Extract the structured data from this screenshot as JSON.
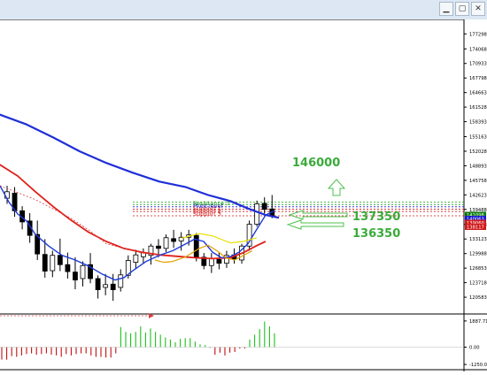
{
  "window": {
    "buttons": [
      {
        "name": "minimize-button",
        "glyph": "▁"
      },
      {
        "name": "maximize-button",
        "glyph": "▢"
      },
      {
        "name": "close-button",
        "glyph": "✕"
      }
    ]
  },
  "price_axis": {
    "ticks": [
      "177298",
      "174068",
      "170933",
      "167798",
      "164663",
      "161528",
      "158393",
      "155163",
      "152028",
      "148893",
      "145758",
      "142623",
      "139488",
      "136258",
      "133123",
      "129988",
      "126853",
      "123718",
      "120583"
    ]
  },
  "price_markers": [
    {
      "label": "141098",
      "color": "#0a7a0a"
    },
    {
      "label": "140063",
      "color": "#1a1ad0"
    },
    {
      "label": "139060",
      "color": "#d01a1a"
    },
    {
      "label": "138117",
      "color": "#d01a1a"
    }
  ],
  "level_labels": [
    {
      "text": "Resistance 3",
      "color": "#19a019"
    },
    {
      "text": "Pivot level",
      "color": "#1a1ad0"
    },
    {
      "text": "Support 1",
      "color": "#d01a1a"
    },
    {
      "text": "Support 2",
      "color": "#d01a1a"
    },
    {
      "text": "Support 3",
      "color": "#d01a1a"
    }
  ],
  "annotations": {
    "target_up": "146000",
    "level_a": "137350",
    "level_b": "136350",
    "text_color": "#3aab3a"
  },
  "osc_axis": {
    "ticks": [
      "1887.71",
      "0.00",
      "-1250.00"
    ]
  },
  "chart_data": {
    "type": "candlestick",
    "title": "",
    "ylim": [
      118500,
      178500
    ],
    "candles": [
      {
        "o": 141900,
        "h": 144600,
        "l": 140700,
        "c": 143300
      },
      {
        "o": 143000,
        "h": 144300,
        "l": 137900,
        "c": 139200
      },
      {
        "o": 139200,
        "h": 140200,
        "l": 135200,
        "c": 136800
      },
      {
        "o": 137000,
        "h": 138700,
        "l": 132300,
        "c": 133900
      },
      {
        "o": 134100,
        "h": 137100,
        "l": 128600,
        "c": 129900
      },
      {
        "o": 129800,
        "h": 133100,
        "l": 124800,
        "c": 126200
      },
      {
        "o": 126300,
        "h": 130600,
        "l": 124900,
        "c": 129600
      },
      {
        "o": 129600,
        "h": 133200,
        "l": 126200,
        "c": 127600
      },
      {
        "o": 127600,
        "h": 130200,
        "l": 124600,
        "c": 126100
      },
      {
        "o": 126000,
        "h": 129200,
        "l": 122300,
        "c": 124300
      },
      {
        "o": 124600,
        "h": 128300,
        "l": 122900,
        "c": 127400
      },
      {
        "o": 127600,
        "h": 130100,
        "l": 123600,
        "c": 124600
      },
      {
        "o": 124600,
        "h": 125300,
        "l": 120300,
        "c": 122200
      },
      {
        "o": 122700,
        "h": 125600,
        "l": 121000,
        "c": 123300
      },
      {
        "o": 123400,
        "h": 125600,
        "l": 119800,
        "c": 122200
      },
      {
        "o": 122700,
        "h": 126600,
        "l": 121800,
        "c": 125400
      },
      {
        "o": 125300,
        "h": 129600,
        "l": 124600,
        "c": 128500
      },
      {
        "o": 128100,
        "h": 130800,
        "l": 126600,
        "c": 129700
      },
      {
        "o": 129300,
        "h": 131100,
        "l": 127800,
        "c": 130200
      },
      {
        "o": 129600,
        "h": 132100,
        "l": 127600,
        "c": 131600
      },
      {
        "o": 131600,
        "h": 133100,
        "l": 129200,
        "c": 131100
      },
      {
        "o": 131100,
        "h": 134100,
        "l": 130300,
        "c": 133400
      },
      {
        "o": 133200,
        "h": 135100,
        "l": 131200,
        "c": 132600
      },
      {
        "o": 132700,
        "h": 134600,
        "l": 130600,
        "c": 133500
      },
      {
        "o": 133500,
        "h": 135100,
        "l": 131700,
        "c": 134000
      },
      {
        "o": 133900,
        "h": 134400,
        "l": 128300,
        "c": 129100
      },
      {
        "o": 129200,
        "h": 130100,
        "l": 126600,
        "c": 127400
      },
      {
        "o": 127400,
        "h": 130100,
        "l": 125800,
        "c": 128900
      },
      {
        "o": 128700,
        "h": 130200,
        "l": 126600,
        "c": 127900
      },
      {
        "o": 127900,
        "h": 130600,
        "l": 126900,
        "c": 129600
      },
      {
        "o": 129700,
        "h": 131100,
        "l": 127800,
        "c": 128800
      },
      {
        "o": 128600,
        "h": 132100,
        "l": 127800,
        "c": 131600
      },
      {
        "o": 131600,
        "h": 137100,
        "l": 130600,
        "c": 136300
      },
      {
        "o": 136300,
        "h": 141400,
        "l": 135800,
        "c": 140700
      },
      {
        "o": 140800,
        "h": 142100,
        "l": 138600,
        "c": 139500
      },
      {
        "o": 139600,
        "h": 142600,
        "l": 137600,
        "c": 138200
      }
    ],
    "series": [
      {
        "color": "#1f2fd8",
        "width": 2.2,
        "values": [
          [
            -30,
            160500
          ],
          [
            0,
            159900
          ],
          [
            30,
            157800
          ],
          [
            60,
            155000
          ],
          [
            90,
            152000
          ],
          [
            120,
            149500
          ],
          [
            150,
            147400
          ],
          [
            180,
            145500
          ],
          [
            210,
            144300
          ],
          [
            235,
            142600
          ],
          [
            260,
            141300
          ],
          [
            280,
            139700
          ],
          [
            300,
            138300
          ],
          [
            315,
            137700
          ]
        ]
      },
      {
        "color": "#e0201a",
        "width": 1.8,
        "values": [
          [
            -30,
            150500
          ],
          [
            0,
            149100
          ],
          [
            20,
            146700
          ],
          [
            40,
            143300
          ],
          [
            60,
            140100
          ],
          [
            80,
            137200
          ],
          [
            100,
            134600
          ],
          [
            120,
            132600
          ],
          [
            140,
            131100
          ],
          [
            160,
            130300
          ],
          [
            180,
            129700
          ],
          [
            200,
            129400
          ],
          [
            220,
            129100
          ],
          [
            240,
            128900
          ],
          [
            260,
            129100
          ],
          [
            275,
            130200
          ],
          [
            290,
            131700
          ],
          [
            300,
            132600
          ]
        ]
      },
      {
        "color": "#1e3ad8",
        "width": 1.4,
        "values": [
          [
            0,
            144600
          ],
          [
            10,
            141100
          ],
          [
            20,
            138500
          ],
          [
            30,
            137000
          ],
          [
            40,
            134100
          ],
          [
            55,
            131600
          ],
          [
            70,
            129600
          ],
          [
            85,
            128600
          ],
          [
            100,
            127300
          ],
          [
            115,
            125600
          ],
          [
            130,
            124300
          ],
          [
            140,
            124800
          ],
          [
            150,
            126300
          ],
          [
            165,
            128300
          ],
          [
            180,
            129600
          ],
          [
            195,
            130600
          ],
          [
            210,
            132100
          ],
          [
            220,
            133100
          ],
          [
            230,
            132600
          ],
          [
            240,
            130300
          ],
          [
            250,
            129100
          ],
          [
            260,
            129300
          ],
          [
            270,
            130300
          ],
          [
            280,
            132100
          ],
          [
            290,
            135200
          ],
          [
            300,
            138300
          ],
          [
            310,
            139200
          ]
        ]
      },
      {
        "color": "#d04040",
        "width": 0.8,
        "dash": "2,2",
        "values": [
          [
            0,
            144600
          ],
          [
            40,
            141600
          ],
          [
            80,
            137600
          ],
          [
            100,
            135100
          ],
          [
            120,
            132100
          ],
          [
            140,
            131100
          ],
          [
            160,
            130100
          ],
          [
            180,
            129700
          ]
        ]
      },
      {
        "color": "#e0a000",
        "width": 1.2,
        "values": [
          [
            175,
            128600
          ],
          [
            185,
            128100
          ],
          [
            195,
            128300
          ],
          [
            210,
            129300
          ],
          [
            225,
            131100
          ],
          [
            235,
            131800
          ],
          [
            245,
            130600
          ],
          [
            255,
            129100
          ],
          [
            265,
            128600
          ],
          [
            275,
            129600
          ],
          [
            285,
            130600
          ]
        ]
      },
      {
        "color": "#e8e000",
        "width": 1.2,
        "values": [
          [
            205,
            133300
          ],
          [
            225,
            134300
          ],
          [
            240,
            133800
          ],
          [
            260,
            132300
          ],
          [
            275,
            132600
          ],
          [
            290,
            133400
          ]
        ]
      }
    ],
    "levels": [
      {
        "value": 141098,
        "color": "#19a019"
      },
      {
        "value": 140563,
        "color": "#19a019"
      },
      {
        "value": 140063,
        "color": "#1a1ad0"
      },
      {
        "value": 139560,
        "color": "#d01a1a"
      },
      {
        "value": 139060,
        "color": "#d01a1a"
      },
      {
        "value": 138117,
        "color": "#d01a1a"
      }
    ],
    "oscillator": {
      "ylim": [
        -1500,
        2200
      ],
      "bars": [
        -900,
        -900,
        -650,
        -700,
        -600,
        -500,
        -450,
        -550,
        -500,
        -450,
        -550,
        -600,
        -700,
        -500,
        -600,
        -500,
        -450,
        -450,
        -600,
        -700,
        -700,
        -750,
        -750,
        -450,
        1450,
        1100,
        1000,
        1100,
        1500,
        1050,
        1350,
        1100,
        900,
        700,
        550,
        350,
        600,
        650,
        650,
        400,
        200,
        150,
        -50,
        -550,
        -400,
        -600,
        -400,
        -350,
        -100,
        -100,
        550,
        900,
        1300,
        1850,
        1500,
        1000
      ]
    }
  }
}
